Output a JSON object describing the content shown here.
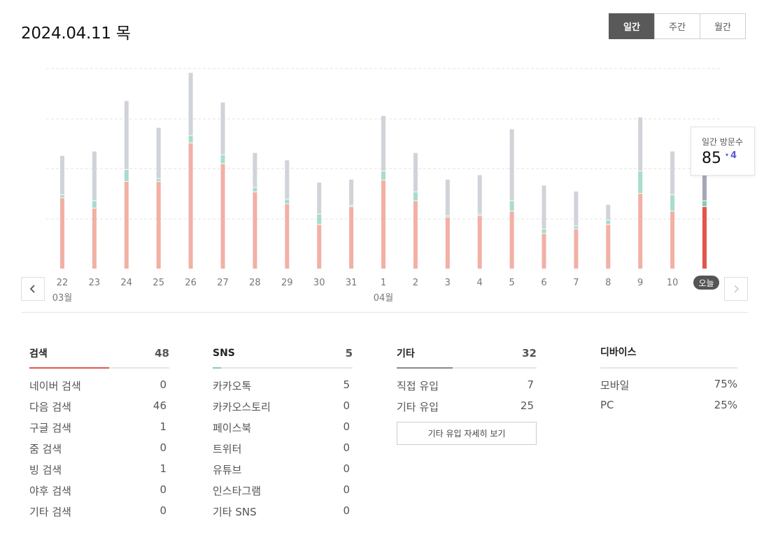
{
  "header": {
    "date": "2024.04.11 목"
  },
  "period_tabs": [
    {
      "label": "일간",
      "active": true
    },
    {
      "label": "주간",
      "active": false
    },
    {
      "label": "월간",
      "active": false
    }
  ],
  "chart_data": {
    "type": "bar",
    "stacked": true,
    "categories": [
      "22",
      "23",
      "24",
      "25",
      "26",
      "27",
      "28",
      "29",
      "30",
      "31",
      "1",
      "2",
      "3",
      "4",
      "5",
      "6",
      "7",
      "8",
      "9",
      "10",
      "오늘"
    ],
    "month_labels": [
      {
        "at": "22",
        "label": "03월"
      },
      {
        "at": "1",
        "label": "04월"
      }
    ],
    "ylim": [
      0,
      135
    ],
    "grid": "dashed",
    "series": [
      {
        "values": [
          48,
          41,
          59,
          59,
          85,
          71,
          52,
          44,
          30,
          42,
          60,
          46,
          35,
          36,
          39,
          24,
          27,
          30,
          51,
          39,
          42
        ]
      },
      {
        "values": [
          2,
          5,
          8,
          2,
          5,
          6,
          3,
          3,
          7,
          1,
          6,
          6,
          1,
          1,
          7,
          3,
          2,
          3,
          15,
          11,
          4
        ]
      },
      {
        "values": [
          26,
          33,
          46,
          34,
          42,
          35,
          23,
          26,
          21,
          17,
          37,
          26,
          24,
          26,
          48,
          29,
          23,
          10,
          36,
          29,
          30
        ]
      }
    ],
    "colors": {
      "search": "#f2b0a6",
      "sns": "#a8dccd",
      "other": "#d0d3d9",
      "today_search": "#e0574a",
      "today_sns": "#7fcfb8",
      "today_other": "#a5a8b4"
    },
    "today_index": 20
  },
  "tooltip": {
    "label": "일간 방문수",
    "value": "85",
    "delta_symbol": "▾",
    "delta": "4"
  },
  "today_label": "오늘",
  "stats": {
    "search": {
      "title": "검색",
      "total": "48",
      "fill": 0.57,
      "color": "#e0574a",
      "rows": [
        {
          "label": "네이버 검색",
          "value": "0"
        },
        {
          "label": "다음 검색",
          "value": "46"
        },
        {
          "label": "구글 검색",
          "value": "1"
        },
        {
          "label": "줌 검색",
          "value": "0"
        },
        {
          "label": "빙 검색",
          "value": "1"
        },
        {
          "label": "야후 검색",
          "value": "0"
        },
        {
          "label": "기타 검색",
          "value": "0"
        }
      ]
    },
    "sns": {
      "title": "SNS",
      "total": "5",
      "fill": 0.06,
      "color": "#7fcfb8",
      "rows": [
        {
          "label": "카카오톡",
          "value": "5"
        },
        {
          "label": "카카오스토리",
          "value": "0"
        },
        {
          "label": "페이스북",
          "value": "0"
        },
        {
          "label": "트위터",
          "value": "0"
        },
        {
          "label": "유튜브",
          "value": "0"
        },
        {
          "label": "인스타그램",
          "value": "0"
        },
        {
          "label": "기타 SNS",
          "value": "0"
        }
      ]
    },
    "other": {
      "title": "기타",
      "total": "32",
      "fill": 0.4,
      "color": "#8a8a8a",
      "rows": [
        {
          "label": "직접 유입",
          "value": "7"
        },
        {
          "label": "기타 유입",
          "value": "25"
        }
      ],
      "detail_button": "기타 유입 자세히 보기"
    },
    "device": {
      "title": "디바이스",
      "rows": [
        {
          "label": "모바일",
          "value": "75%"
        },
        {
          "label": "PC",
          "value": "25%"
        }
      ]
    }
  }
}
